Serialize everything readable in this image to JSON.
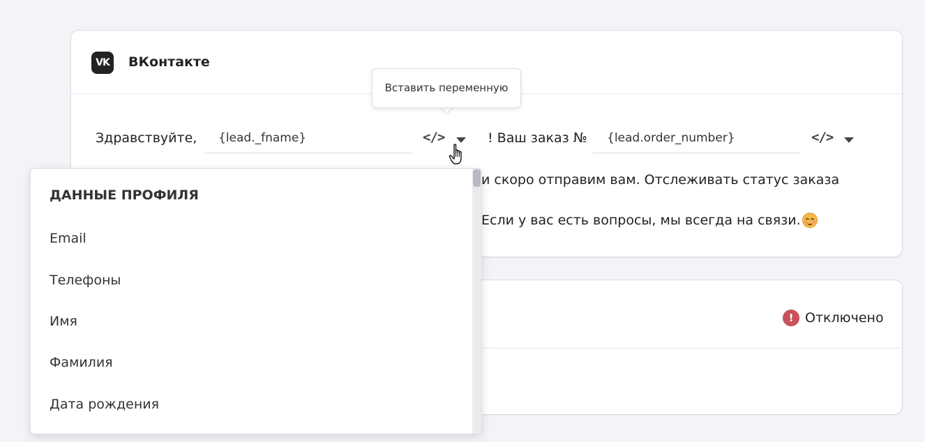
{
  "vk_card": {
    "title": "ВКонтакте",
    "logo_text": "VK",
    "message": {
      "greeting": "Здравствуйте,",
      "var1": "{lead._fname}",
      "after_var1": "! Ваш заказ №",
      "var2": "{lead.order_number}",
      "line2_visible": "и скоро отправим вам. Отслеживать статус заказа",
      "line3_visible": "Если у вас есть вопросы, мы всегда на связи."
    },
    "code_icon_glyph": "</>"
  },
  "tooltip": {
    "text": "Вставить переменную"
  },
  "second_card": {
    "status_text": "Отключено",
    "status_icon_glyph": "!",
    "status_color": "#c9515d"
  },
  "dropdown": {
    "heading": "ДАННЫЕ ПРОФИЛЯ",
    "items": [
      "Email",
      "Телефоны",
      "Имя",
      "Фамилия",
      "Дата рождения"
    ]
  }
}
